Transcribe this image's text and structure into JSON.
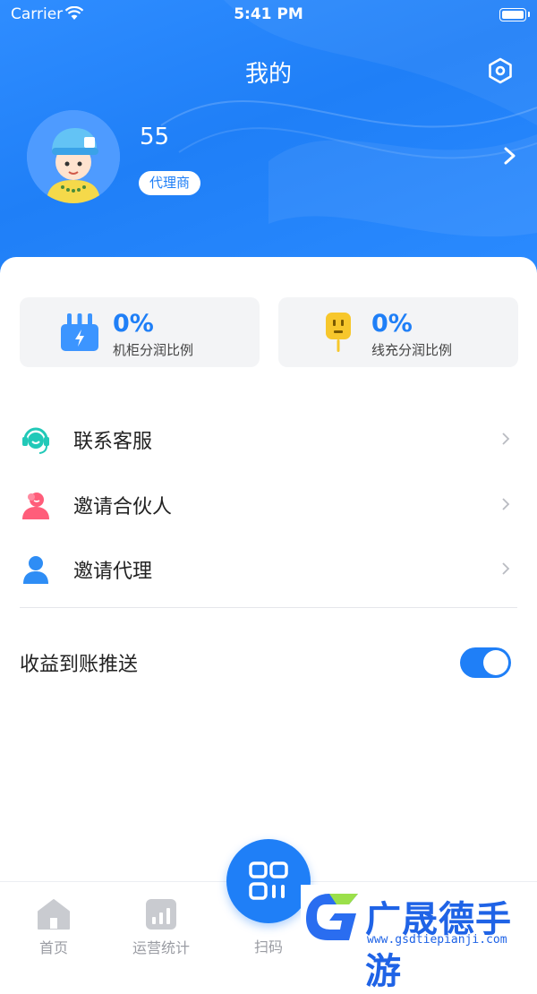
{
  "status_bar": {
    "carrier": "Carrier",
    "time": "5:41 PM"
  },
  "header": {
    "title": "我的"
  },
  "profile": {
    "name": "55",
    "role": "代理商"
  },
  "stats": [
    {
      "value": "0%",
      "label": "机柜分润比例",
      "icon": "cabinet-icon"
    },
    {
      "value": "0%",
      "label": "线充分润比例",
      "icon": "plug-icon"
    }
  ],
  "menu": [
    {
      "label": "联系客服",
      "icon": "headset-icon"
    },
    {
      "label": "邀请合伙人",
      "icon": "partner-icon"
    },
    {
      "label": "邀请代理",
      "icon": "user-icon"
    }
  ],
  "push": {
    "label": "收益到账推送",
    "enabled": true
  },
  "tabs": [
    {
      "label": "首页",
      "icon": "home-icon"
    },
    {
      "label": "运营统计",
      "icon": "chart-icon"
    },
    {
      "label": "扫码",
      "icon": "scan-icon"
    }
  ],
  "watermark": {
    "title": "广晟德手游",
    "url": "www.gsdtiepianji.com"
  },
  "colors": {
    "primary": "#1f7ff7",
    "card_bg": "#f3f4f6",
    "text": "#222222",
    "muted": "#9a9ca3"
  }
}
